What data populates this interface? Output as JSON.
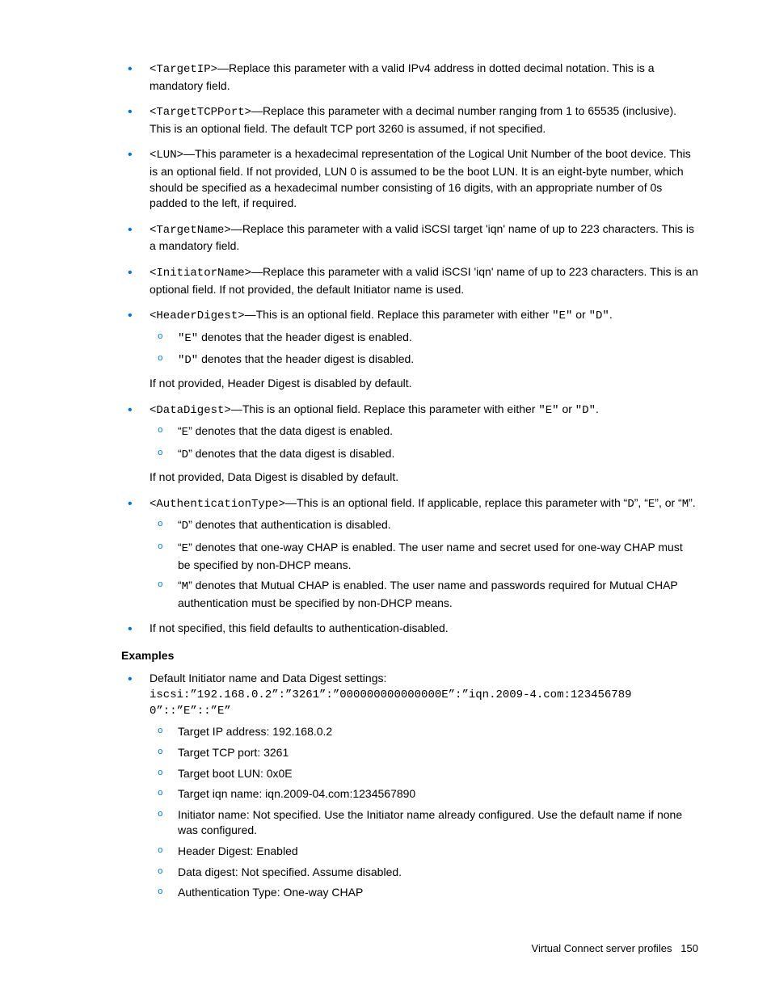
{
  "items": [
    {
      "code": "<TargetIP>",
      "text": "—Replace this parameter with a valid IPv4 address in dotted decimal notation. This is a mandatory field."
    },
    {
      "code": "<TargetTCPPort>",
      "text": "—Replace this parameter with a decimal number ranging from 1 to 65535 (inclusive). This is an optional field. The default TCP port 3260 is assumed, if not specified."
    },
    {
      "code": "<LUN>",
      "text": "—This parameter is a hexadecimal representation of the Logical Unit Number of the boot device. This is an optional field. If not provided, LUN 0 is assumed to be the boot LUN. It is an eight-byte number, which should be specified as a hexadecimal number consisting of 16 digits, with an appropriate number of 0s padded to the left, if required."
    },
    {
      "code": "<TargetName>",
      "text": "—Replace this parameter with a valid iSCSI target 'iqn' name of up to 223 characters. This is a mandatory field."
    },
    {
      "code": "<InitiatorName>",
      "text": "—Replace this parameter with a valid iSCSI 'iqn' name of up to 223 characters. This is an optional field. If not provided, the default Initiator name is used."
    }
  ],
  "headerDigest": {
    "code": "<HeaderDigest>",
    "intro_a": "—This is an optional field. Replace this parameter with either ",
    "e": "\"E\"",
    "or": " or ",
    "d": "\"D\"",
    "dot": ".",
    "sub1_code": "\"E\"",
    "sub1_text": " denotes that the header digest is enabled.",
    "sub2_code": "\"D\"",
    "sub2_text": " denotes that the header digest is disabled.",
    "after": "If not provided, Header Digest is disabled by default."
  },
  "dataDigest": {
    "code": "<DataDigest>",
    "intro_a": "—This is an optional field. Replace this parameter with either ",
    "e": "\"E\"",
    "or": " or ",
    "d": "\"D\"",
    "dot": ".",
    "sub1_pre": "“",
    "sub1_code": "E",
    "sub1_post": "” denotes that the data digest is enabled.",
    "sub2_pre": "“",
    "sub2_code": "D",
    "sub2_post": "” denotes that the data digest is disabled.",
    "after": "If not provided, Data Digest is disabled by default."
  },
  "auth": {
    "code": "<AuthenticationType>",
    "intro_a": "—This is an optional field. If applicable, replace this parameter with “",
    "d": "D",
    "mid1": "”, “",
    "e": "E",
    "mid2": "”, or “",
    "m": "M",
    "end": "”.",
    "sub1_pre": "“",
    "sub1_code": "D",
    "sub1_post": "” denotes that authentication is disabled.",
    "sub2_pre": "“",
    "sub2_code": "E",
    "sub2_post": "” denotes that one-way CHAP is enabled. The user name and secret used for one-way CHAP must be specified by non-DHCP means.",
    "sub3_pre": "“",
    "sub3_code": "M",
    "sub3_post": "” denotes that Mutual CHAP is enabled. The user name and passwords required for Mutual CHAP authentication must be specified by non-DHCP means."
  },
  "lastBullet": "If not specified, this field defaults to authentication-disabled.",
  "examplesHeading": "Examples",
  "example": {
    "intro": "Default Initiator name and Data Digest settings:",
    "codeline": "iscsi:”192.168.0.2”:”3261”:”000000000000000E”:”iqn.2009-4.com:1234567890”::”E”::”E”",
    "s1": "Target IP address: 192.168.0.2",
    "s2": "Target TCP port: 3261",
    "s3": "Target boot LUN: 0x0E",
    "s4": "Target iqn name: iqn.2009-04.com:1234567890",
    "s5": "Initiator name: Not specified. Use the Initiator name already configured. Use the default name if none was configured.",
    "s6": "Header Digest: Enabled",
    "s7": "Data digest: Not specified. Assume disabled.",
    "s8": "Authentication Type: One-way CHAP"
  },
  "footer": {
    "text": "Virtual Connect server profiles",
    "page": "150"
  }
}
